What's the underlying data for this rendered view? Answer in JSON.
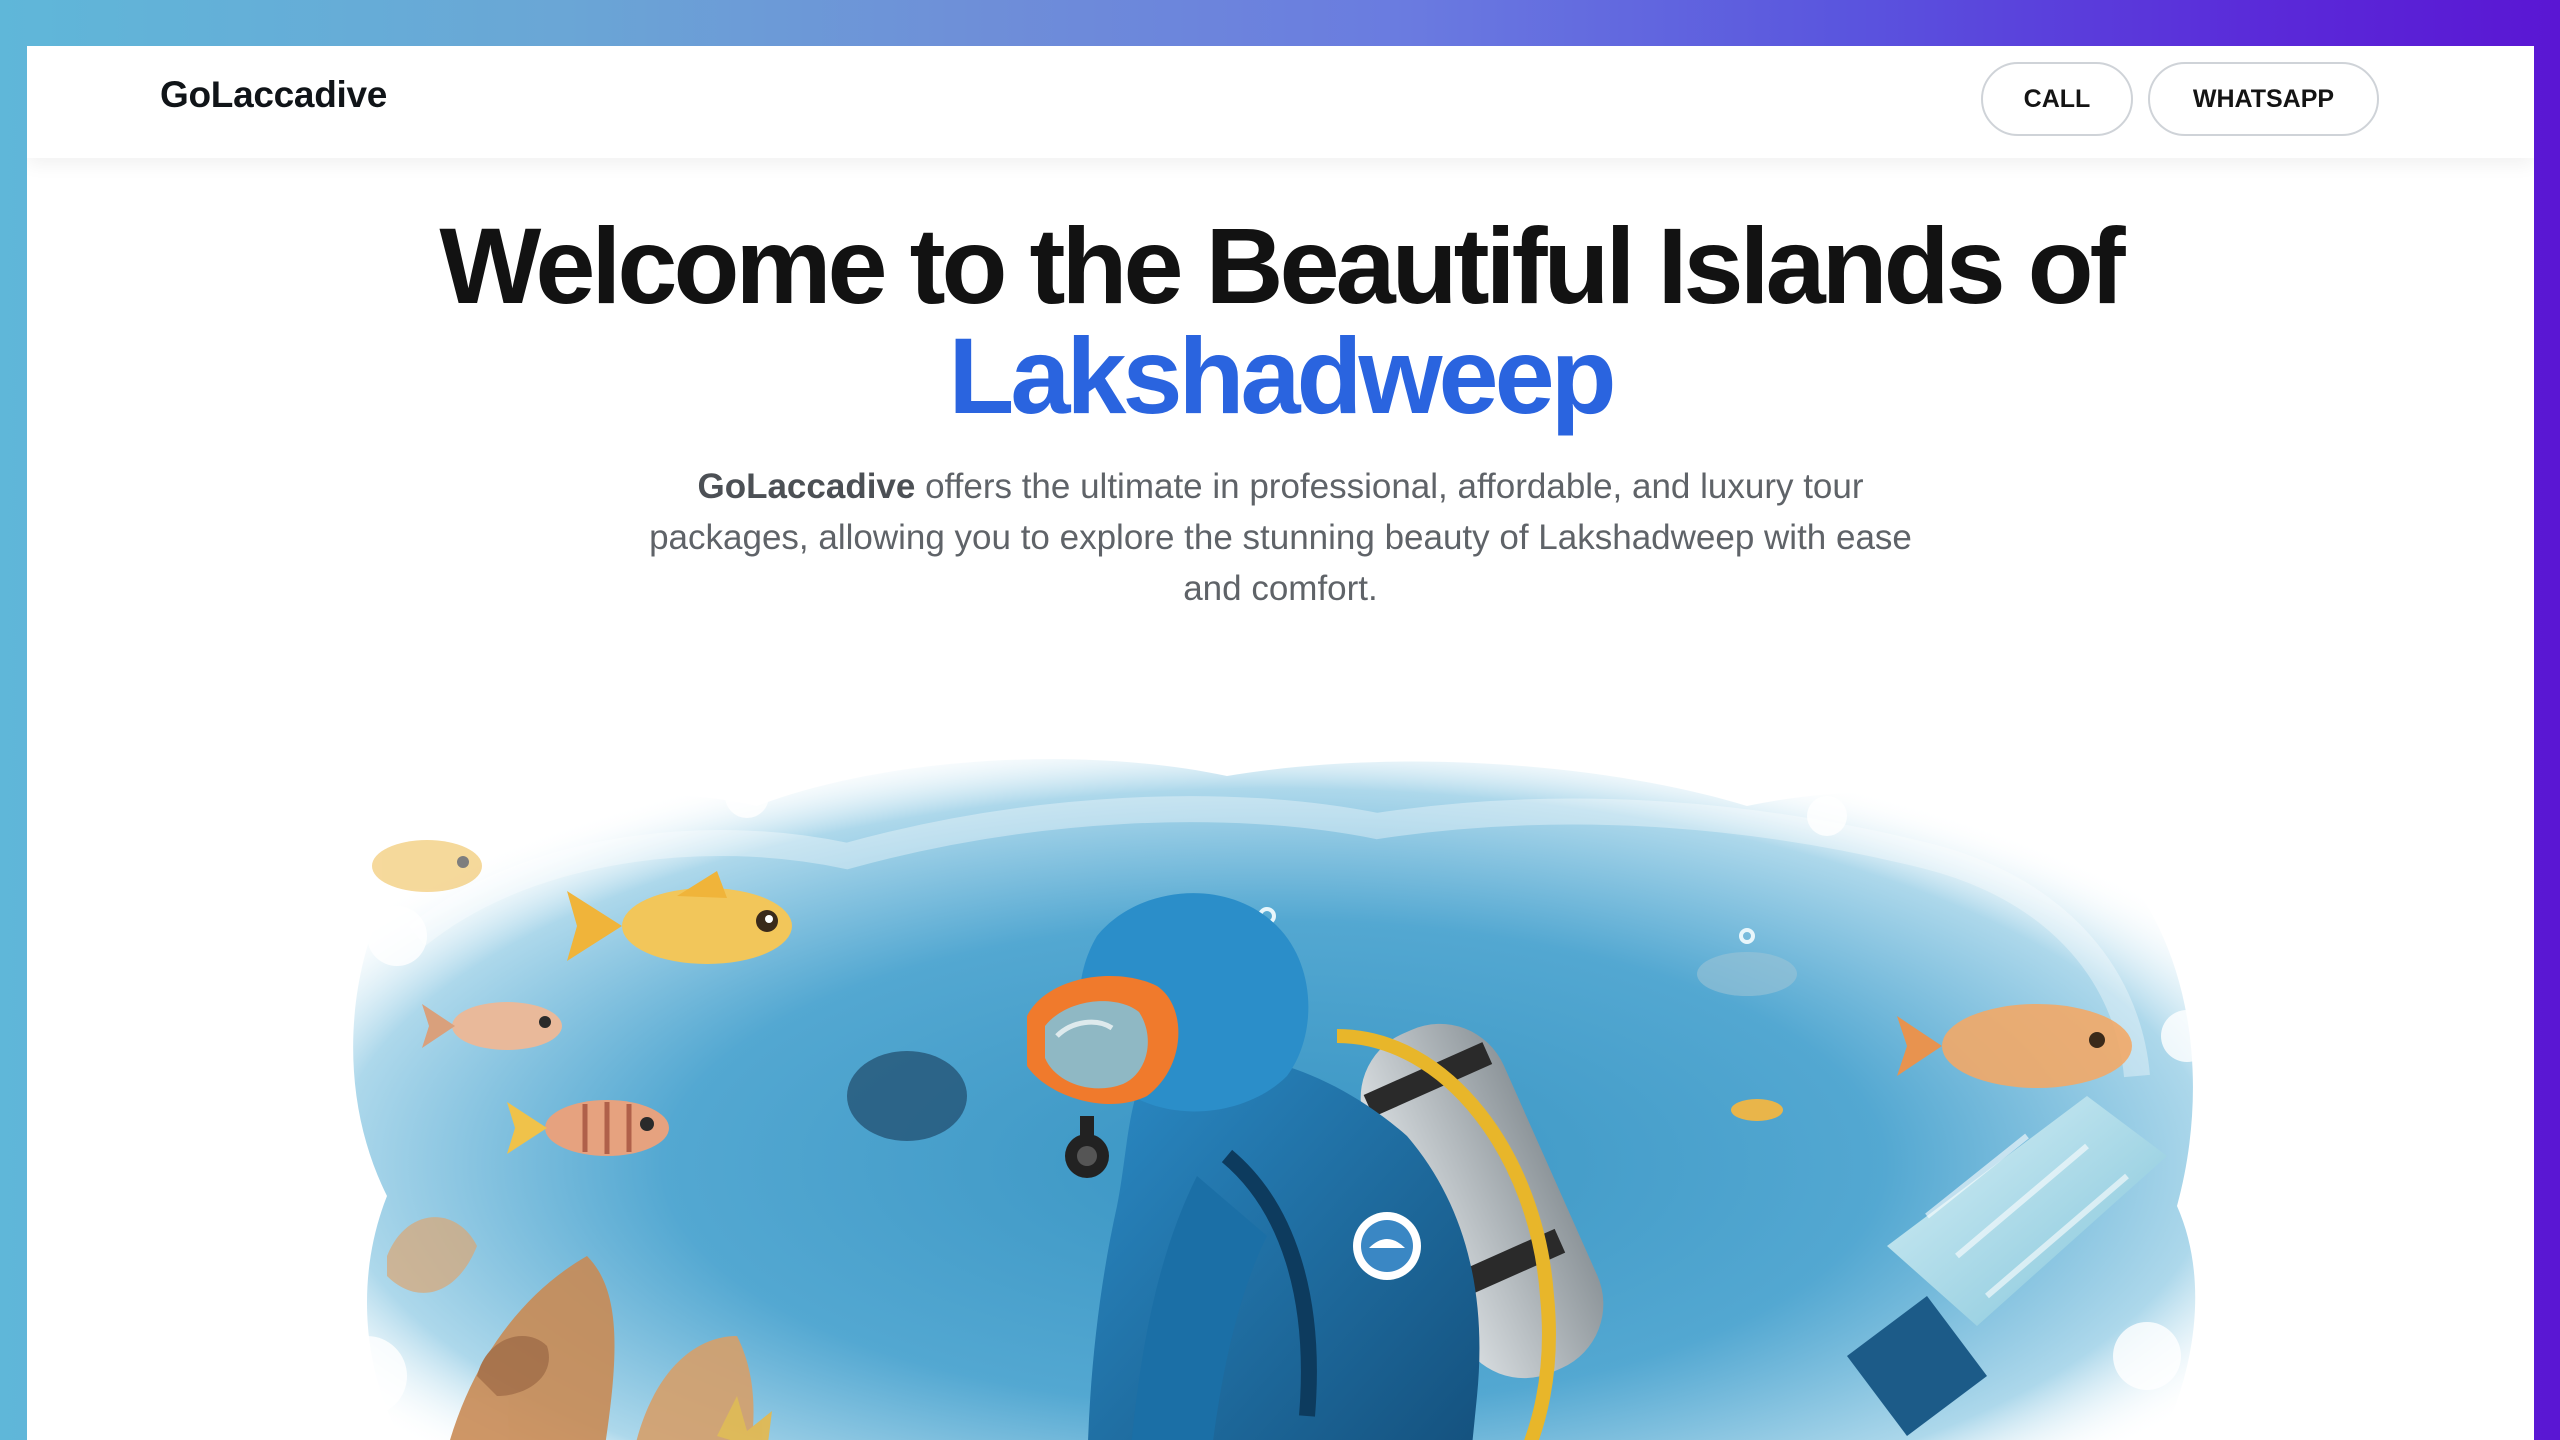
{
  "header": {
    "brand": "GoLaccadive",
    "buttons": {
      "call": "CALL",
      "whatsapp": "WHATSAPP"
    }
  },
  "hero": {
    "title_line1": "Welcome to the Beautiful Islands of",
    "title_line2": "Lakshadweep",
    "description_brand": "GoLaccadive",
    "description_text_1": " offers the ultimate in professional, affordable, and luxury tour",
    "description_text_2": "packages, allowing you to explore the stunning beauty of Lakshadweep with ease",
    "description_text_3": "and comfort."
  },
  "colors": {
    "accent": "#2a64df",
    "title": "#121212",
    "body_text": "#5f6368",
    "background_gradient_start": "#5fb7d9",
    "background_gradient_end": "#5a16d3"
  },
  "illustration": {
    "subject": "scuba-diver-underwater-illustration"
  }
}
